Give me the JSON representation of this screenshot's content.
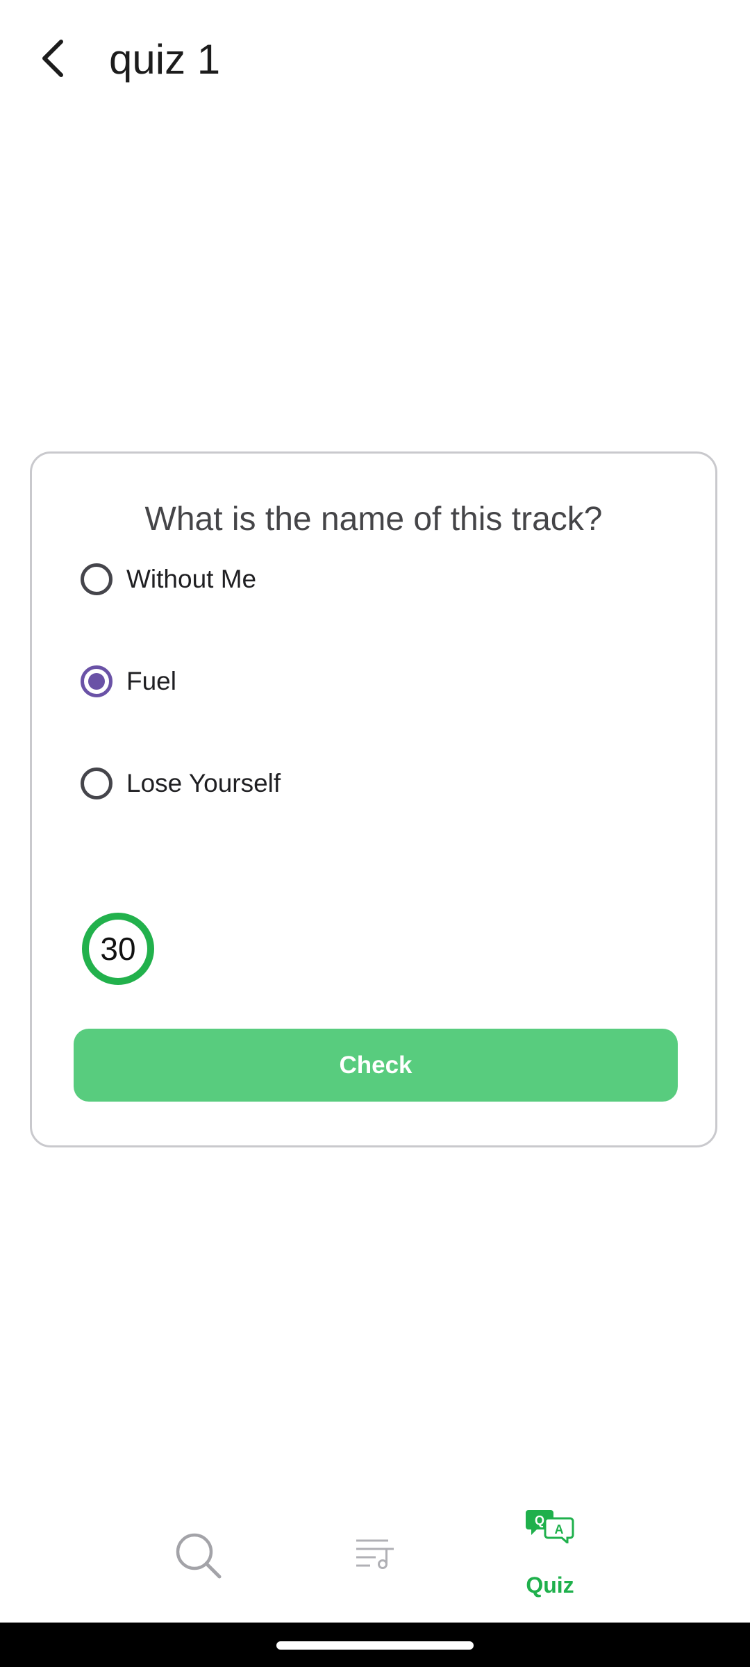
{
  "app_bar": {
    "title": "quiz 1"
  },
  "quiz": {
    "question": "What is the name of this track?",
    "options": [
      {
        "label": "Without Me",
        "selected": false
      },
      {
        "label": "Fuel",
        "selected": true
      },
      {
        "label": "Lose Yourself",
        "selected": false
      }
    ],
    "timer_value": "30",
    "check_label": "Check"
  },
  "bottom_nav": {
    "items": [
      {
        "icon": "search-icon",
        "label": "",
        "active": false
      },
      {
        "icon": "playlist-icon",
        "label": "",
        "active": false
      },
      {
        "icon": "quiz-icon",
        "label": "Quiz",
        "active": true
      }
    ]
  },
  "colors": {
    "accent_green": "#22b14c",
    "button_green": "#58cc7e",
    "radio_selected": "#6a52a6",
    "nav_inactive": "#a3a3a8"
  }
}
